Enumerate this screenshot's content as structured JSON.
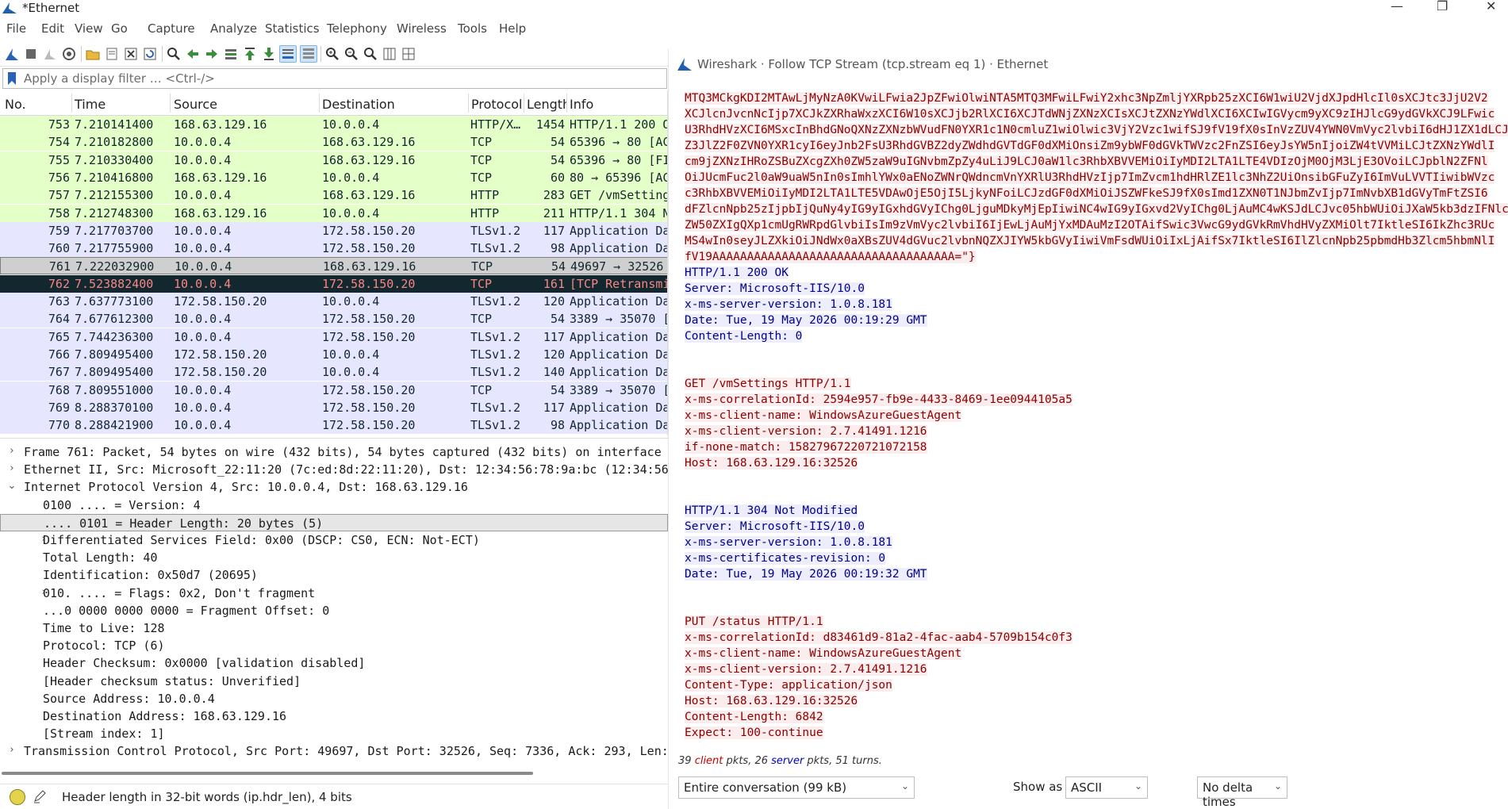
{
  "window": {
    "title": "*Ethernet"
  },
  "window_controls": {
    "minimize": "—",
    "maximize": "❐",
    "close": "✕"
  },
  "menu": [
    "File",
    "Edit",
    "View",
    "Go",
    "Capture",
    "Analyze",
    "Statistics",
    "Telephony",
    "Wireless",
    "Tools",
    "Help"
  ],
  "filter": {
    "placeholder": "Apply a display filter … <Ctrl-/>"
  },
  "columns": {
    "no": "No.",
    "time": "Time",
    "source": "Source",
    "destination": "Destination",
    "protocol": "Protocol",
    "length": "Length",
    "info": "Info"
  },
  "packets": [
    {
      "no": "753",
      "time": "7.210141400",
      "src": "168.63.129.16",
      "dst": "10.0.0.4",
      "proto": "HTTP/X…",
      "len": "1454",
      "info": "HTTP/1.1 200 O",
      "bg": "#e4ffc7",
      "fg": "#12272e"
    },
    {
      "no": "754",
      "time": "7.210182800",
      "src": "10.0.0.4",
      "dst": "168.63.129.16",
      "proto": "TCP",
      "len": "54",
      "info": "65396 → 80 [AC",
      "bg": "#e4ffc7",
      "fg": "#12272e"
    },
    {
      "no": "755",
      "time": "7.210330400",
      "src": "10.0.0.4",
      "dst": "168.63.129.16",
      "proto": "TCP",
      "len": "54",
      "info": "65396 → 80 [FI",
      "bg": "#e4ffc7",
      "fg": "#12272e"
    },
    {
      "no": "756",
      "time": "7.210416800",
      "src": "168.63.129.16",
      "dst": "10.0.0.4",
      "proto": "TCP",
      "len": "60",
      "info": "80 → 65396 [AC",
      "bg": "#e4ffc7",
      "fg": "#12272e"
    },
    {
      "no": "757",
      "time": "7.212155300",
      "src": "10.0.0.4",
      "dst": "168.63.129.16",
      "proto": "HTTP",
      "len": "283",
      "info": "GET /vmSetting",
      "bg": "#e4ffc7",
      "fg": "#12272e"
    },
    {
      "no": "758",
      "time": "7.212748300",
      "src": "168.63.129.16",
      "dst": "10.0.0.4",
      "proto": "HTTP",
      "len": "211",
      "info": "HTTP/1.1 304 N",
      "bg": "#e4ffc7",
      "fg": "#12272e"
    },
    {
      "no": "759",
      "time": "7.217703700",
      "src": "10.0.0.4",
      "dst": "172.58.150.20",
      "proto": "TLSv1.2",
      "len": "117",
      "info": "Application Da",
      "bg": "#e7e6ff",
      "fg": "#12272e"
    },
    {
      "no": "760",
      "time": "7.217755900",
      "src": "10.0.0.4",
      "dst": "172.58.150.20",
      "proto": "TLSv1.2",
      "len": "98",
      "info": "Application Da",
      "bg": "#e7e6ff",
      "fg": "#12272e"
    },
    {
      "no": "761",
      "time": "7.222032900",
      "src": "10.0.0.4",
      "dst": "168.63.129.16",
      "proto": "TCP",
      "len": "54",
      "info": "49697 → 32526",
      "bg": "#cfcfcf",
      "fg": "#12272e"
    },
    {
      "no": "762",
      "time": "7.523882400",
      "src": "10.0.0.4",
      "dst": "172.58.150.20",
      "proto": "TCP",
      "len": "161",
      "info": "[TCP Retransmi",
      "bg": "#12272e",
      "fg": "#f78787"
    },
    {
      "no": "763",
      "time": "7.637773100",
      "src": "172.58.150.20",
      "dst": "10.0.0.4",
      "proto": "TLSv1.2",
      "len": "120",
      "info": "Application Da",
      "bg": "#e7e6ff",
      "fg": "#12272e"
    },
    {
      "no": "764",
      "time": "7.677612300",
      "src": "10.0.0.4",
      "dst": "172.58.150.20",
      "proto": "TCP",
      "len": "54",
      "info": "3389 → 35070 [",
      "bg": "#e7e6ff",
      "fg": "#12272e"
    },
    {
      "no": "765",
      "time": "7.744236300",
      "src": "10.0.0.4",
      "dst": "172.58.150.20",
      "proto": "TLSv1.2",
      "len": "117",
      "info": "Application Da",
      "bg": "#e7e6ff",
      "fg": "#12272e"
    },
    {
      "no": "766",
      "time": "7.809495400",
      "src": "172.58.150.20",
      "dst": "10.0.0.4",
      "proto": "TLSv1.2",
      "len": "120",
      "info": "Application Da",
      "bg": "#e7e6ff",
      "fg": "#12272e"
    },
    {
      "no": "767",
      "time": "7.809495400",
      "src": "172.58.150.20",
      "dst": "10.0.0.4",
      "proto": "TLSv1.2",
      "len": "140",
      "info": "Application Da",
      "bg": "#e7e6ff",
      "fg": "#12272e"
    },
    {
      "no": "768",
      "time": "7.809551000",
      "src": "10.0.0.4",
      "dst": "172.58.150.20",
      "proto": "TCP",
      "len": "54",
      "info": "3389 → 35070 [",
      "bg": "#e7e6ff",
      "fg": "#12272e"
    },
    {
      "no": "769",
      "time": "8.288370100",
      "src": "10.0.0.4",
      "dst": "172.58.150.20",
      "proto": "TLSv1.2",
      "len": "117",
      "info": "Application Da",
      "bg": "#e7e6ff",
      "fg": "#12272e"
    },
    {
      "no": "770",
      "time": "8.288421900",
      "src": "10.0.0.4",
      "dst": "172.58.150.20",
      "proto": "TLSv1.2",
      "len": "98",
      "info": "Application Da",
      "bg": "#e7e6ff",
      "fg": "#12272e"
    }
  ],
  "details": [
    {
      "indent": 0,
      "arrow": "›",
      "text": "Frame 761: Packet, 54 bytes on wire (432 bits), 54 bytes captured (432 bits) on interface \\"
    },
    {
      "indent": 0,
      "arrow": "›",
      "text": "Ethernet II, Src: Microsoft_22:11:20 (7c:ed:8d:22:11:20), Dst: 12:34:56:78:9a:bc (12:34:56:"
    },
    {
      "indent": 0,
      "arrow": "⌄",
      "text": "Internet Protocol Version 4, Src: 10.0.0.4, Dst: 168.63.129.16"
    },
    {
      "indent": 1,
      "arrow": "",
      "text": "0100 .... = Version: 4"
    },
    {
      "indent": 1,
      "arrow": "",
      "text": ".... 0101 = Header Length: 20 bytes (5)",
      "selected": true
    },
    {
      "indent": 1,
      "arrow": "›",
      "text": "Differentiated Services Field: 0x00 (DSCP: CS0, ECN: Not-ECT)"
    },
    {
      "indent": 1,
      "arrow": "",
      "text": "Total Length: 40"
    },
    {
      "indent": 1,
      "arrow": "",
      "text": "Identification: 0x50d7 (20695)"
    },
    {
      "indent": 1,
      "arrow": "›",
      "text": "010. .... = Flags: 0x2, Don't fragment"
    },
    {
      "indent": 1,
      "arrow": "",
      "text": "...0 0000 0000 0000 = Fragment Offset: 0"
    },
    {
      "indent": 1,
      "arrow": "",
      "text": "Time to Live: 128"
    },
    {
      "indent": 1,
      "arrow": "",
      "text": "Protocol: TCP (6)"
    },
    {
      "indent": 1,
      "arrow": "",
      "text": "Header Checksum: 0x0000 [validation disabled]"
    },
    {
      "indent": 1,
      "arrow": "",
      "text": "[Header checksum status: Unverified]"
    },
    {
      "indent": 1,
      "arrow": "",
      "text": "Source Address: 10.0.0.4"
    },
    {
      "indent": 1,
      "arrow": "",
      "text": "Destination Address: 168.63.129.16"
    },
    {
      "indent": 1,
      "arrow": "",
      "text": "[Stream index: 1]"
    },
    {
      "indent": 0,
      "arrow": "›",
      "text": "Transmission Control Protocol, Src Port: 49697, Dst Port: 32526, Seq: 7336, Ack: 293, Len:"
    }
  ],
  "status": {
    "text": "Header length in 32-bit words (ip.hdr_len), 4 bits"
  },
  "follow": {
    "title": "Wireshark · Follow TCP Stream (tcp.stream eq 1) · Ethernet",
    "lines": [
      {
        "t": "MTQ3MCkgKDI2MTAwLjMyNzA0KVwiLFwia2JpZFwiOlwiNTA5MTQ3MFwiLFwiY2xhc3NpZmljYXRpb25zXCI6W1wiU2VjdXJpdHlcIl0sXCJtc3JjU2V2",
        "c": "cl"
      },
      {
        "t": "XCJlcnJvcnNcIjp7XCJkZXRhaWxzXCI6W10sXCJjb2RlXCI6XCJTdWNjZXNzXCIsXCJtZXNzYWdlXCI6XCIwIGVycm9yXC9zIHJlcG9ydGVkXCJ9LFwic",
        "c": "cl"
      },
      {
        "t": "U3RhdHVzXCI6MSxcInBhdGNoQXNzZXNzbWVudFN0YXR1c1N0cmluZ1wiOlwic3VjY2Vzc1wifSJ9fV19fX0sInVzZUV4YWN0VmVyc2lvbiI6dHJ1ZX1dLCJ",
        "c": "cl"
      },
      {
        "t": "Z3JlZ2F0ZVN0YXR1cyI6eyJnb2FsU3RhdGVBZ2dyZWdhdGVTdGF0dXMiOnsiZm9ybWF0dGVkTWVzc2FnZSI6eyJsYW5nIjoiZW4tVVMiLCJtZXNzYWdlI",
        "c": "cl"
      },
      {
        "t": "cm9jZXNzIHRoZSBuZXcgZXh0ZW5zaW9uIGNvbmZpZy4uLiJ9LCJ0aW1lc3RhbXBVVEMiOiIyMDI2LTA1LTE4VDIzOjM0OjM3LjE3OVoiLCJpblN2ZFNl",
        "c": "cl"
      },
      {
        "t": "OiJUcmFuc2l0aW9uaW5nIn0sImhlYWx0aENoZWNrQWdncmVnYXRlU3RhdHVzIjp7ImZvcm1hdHRlZE1lc3NhZ2UiOnsibGFuZyI6ImVuLVVTIiwibWVzc",
        "c": "cl"
      },
      {
        "t": "c3RhbXBVVEMiOiIyMDI2LTA1LTE5VDAwOjE5OjI5LjkyNFoiLCJzdGF0dXMiOiJSZWFkeSJ9fX0sImd1ZXN0T1NJbmZvIjp7ImNvbXB1dGVyTmFtZSI6",
        "c": "cl"
      },
      {
        "t": "dFZlcnNpb25zIjpbIjQuNy4yIG9yIGxhdGVyIChg0LjguMDkyMjEpIiwiNC4wIG9yIGxvd2VyIChg0LjAuMC4wKSJdLCJvc05hbWUiOiJXaW5kb3dzIFNlc",
        "c": "cl"
      },
      {
        "t": "ZW50ZXIgQXp1cmUgRWRpdGlvbiIsIm9zVmVyc2lvbiI6IjEwLjAuMjYxMDAuMzI2OTAifSwic3VwcG9ydGVkRmVhdHVyZXMiOlt7IktleSI6IkZhc3RUc",
        "c": "cl"
      },
      {
        "t": "MS4wIn0seyJLZXkiOiJNdWx0aXBsZUV4dGVuc2lvbnNQZXJIYW5kbGVyIiwiVmFsdWUiOiIxLjAifSx7IktleSI6IlZlcnNpb25pbmdHb3Zlcm5hbmNlI",
        "c": "cl"
      },
      {
        "t": "fV19AAAAAAAAAAAAAAAAAAAAAAAAAAAAAAAAAAA=\"}",
        "c": "cl"
      },
      {
        "t": "HTTP/1.1 200 OK",
        "c": "sv"
      },
      {
        "t": "Server: Microsoft-IIS/10.0",
        "c": "sv"
      },
      {
        "t": "x-ms-server-version: 1.0.8.181",
        "c": "sv"
      },
      {
        "t": "Date: Tue, 19 May 2026 00:19:29 GMT",
        "c": "sv"
      },
      {
        "t": "Content-Length: 0",
        "c": "sv"
      },
      {
        "t": "",
        "c": ""
      },
      {
        "t": "",
        "c": ""
      },
      {
        "t": "GET /vmSettings HTTP/1.1",
        "c": "cl"
      },
      {
        "t": "x-ms-correlationId: 2594e957-fb9e-4433-8469-1ee0944105a5",
        "c": "cl"
      },
      {
        "t": "x-ms-client-name: WindowsAzureGuestAgent",
        "c": "cl"
      },
      {
        "t": "x-ms-client-version: 2.7.41491.1216",
        "c": "cl"
      },
      {
        "t": "if-none-match: 15827967220721072158",
        "c": "cl"
      },
      {
        "t": "Host: 168.63.129.16:32526",
        "c": "cl"
      },
      {
        "t": "",
        "c": ""
      },
      {
        "t": "",
        "c": ""
      },
      {
        "t": "HTTP/1.1 304 Not Modified",
        "c": "sv"
      },
      {
        "t": "Server: Microsoft-IIS/10.0",
        "c": "sv"
      },
      {
        "t": "x-ms-server-version: 1.0.8.181",
        "c": "sv"
      },
      {
        "t": "x-ms-certificates-revision: 0",
        "c": "sv"
      },
      {
        "t": "Date: Tue, 19 May 2026 00:19:32 GMT",
        "c": "sv"
      },
      {
        "t": "",
        "c": ""
      },
      {
        "t": "",
        "c": ""
      },
      {
        "t": "PUT /status HTTP/1.1",
        "c": "cl"
      },
      {
        "t": "x-ms-correlationId: d83461d9-81a2-4fac-aab4-5709b154c0f3",
        "c": "cl"
      },
      {
        "t": "x-ms-client-name: WindowsAzureGuestAgent",
        "c": "cl"
      },
      {
        "t": "x-ms-client-version: 2.7.41491.1216",
        "c": "cl"
      },
      {
        "t": "Content-Type: application/json",
        "c": "cl"
      },
      {
        "t": "Host: 168.63.129.16:32526",
        "c": "cl"
      },
      {
        "t": "Content-Length: 6842",
        "c": "cl"
      },
      {
        "t": "Expect: 100-continue",
        "c": "cl"
      }
    ],
    "summary": {
      "client_count": "39",
      "client_word": "client",
      "mid": " pkts, 26 ",
      "server_word": "server",
      "tail": " pkts, 51 turns."
    },
    "conversation": "Entire conversation (99 kB)",
    "show_as_label": "Show as",
    "show_as": "ASCII",
    "delta": "No delta times"
  }
}
